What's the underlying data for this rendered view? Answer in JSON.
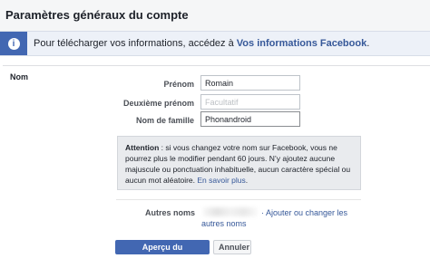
{
  "page": {
    "title": "Paramètres généraux du compte"
  },
  "info": {
    "icon": "info-icon",
    "text": "Pour télécharger vos informations, accédez à ",
    "link": "Vos informations Facebook",
    "suffix": "."
  },
  "section": {
    "label": "Nom"
  },
  "fields": {
    "first_name": {
      "label": "Prénom",
      "value": "Romain"
    },
    "middle_name": {
      "label": "Deuxième prénom",
      "placeholder": "Facultatif"
    },
    "last_name": {
      "label": "Nom de famille",
      "value": "Phonandroid"
    }
  },
  "warning": {
    "bold": "Attention",
    "text": " : si vous changez votre nom sur Facebook, vous ne pourrez plus le modifier pendant 60 jours. N’y ajoutez aucune majuscule ou ponctuation inhabituelle, aucun caractère spécial ou aucun mot aléatoire. ",
    "link": "En savoir plus",
    "suffix": "."
  },
  "other_names": {
    "label": "Autres noms",
    "link": "· Ajouter ou changer les autres noms"
  },
  "buttons": {
    "preview": "Aperçu du changement",
    "cancel": "Annuler"
  },
  "colors": {
    "accent": "#4267b2",
    "link": "#365899",
    "warning_bg": "#e9ebee"
  }
}
